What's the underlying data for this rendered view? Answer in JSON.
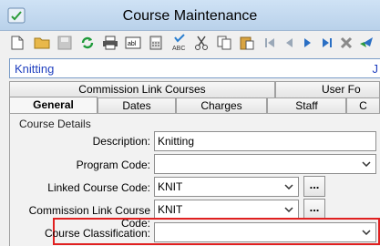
{
  "window": {
    "title": "Course Maintenance"
  },
  "toolbar": {
    "icons": [
      "new-icon",
      "open-icon",
      "save-icon",
      "refresh-icon",
      "print-icon",
      "field-icon",
      "calculator-icon",
      "spellcheck-icon",
      "cut-icon",
      "copy-icon",
      "paste-icon",
      "first-record-icon",
      "previous-record-icon",
      "next-record-icon",
      "last-record-icon",
      "delete-icon",
      "goto-icon"
    ],
    "spell_label": "ABC"
  },
  "record": {
    "name": "Knitting",
    "right_text": "J"
  },
  "tabs": {
    "row1": [
      "Commission Link Courses",
      "User Fo"
    ],
    "row2": [
      "General",
      "Dates",
      "Charges",
      "Staff",
      "C"
    ],
    "active": "General"
  },
  "form": {
    "section": "Course Details",
    "description": {
      "label": "Description:",
      "value": "Knitting"
    },
    "program_code": {
      "label": "Program Code:",
      "value": ""
    },
    "linked_course_code": {
      "label": "Linked Course Code:",
      "value": "KNIT",
      "button": "..."
    },
    "commission_link_course_code": {
      "label": "Commission Link Course Code:",
      "value": "KNIT",
      "button": "..."
    },
    "course_classification": {
      "label": "Course Classification:",
      "value": ""
    }
  },
  "colors": {
    "highlight": "#e02020",
    "record_text": "#1f3fbf"
  }
}
